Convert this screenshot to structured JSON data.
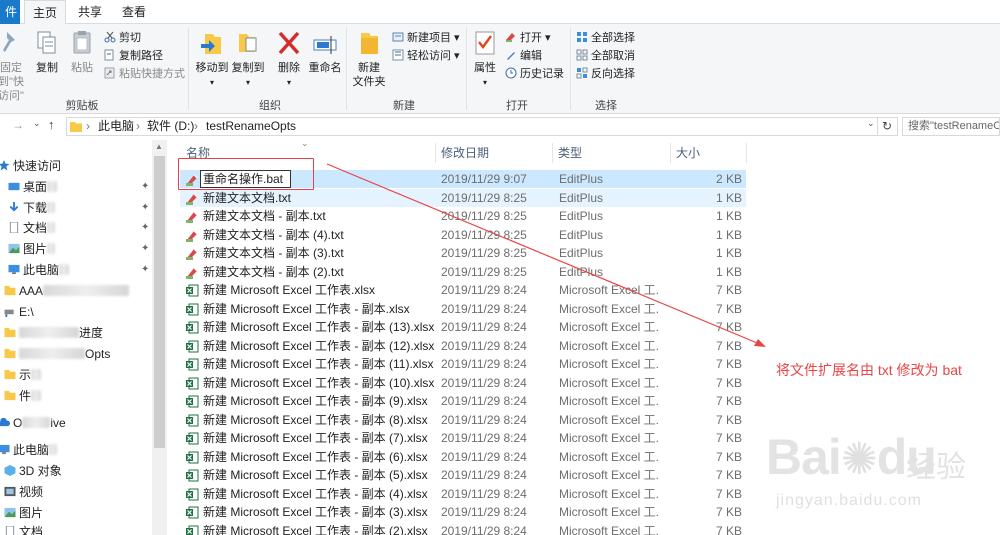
{
  "tabs": {
    "file": "件",
    "home": "主页",
    "share": "共享",
    "view": "查看"
  },
  "ribbon": {
    "clipboard": {
      "pin_label": "固定到\"快",
      "pin_label2": "访问\"",
      "copy": "复制",
      "paste": "粘贴",
      "cut": "剪切",
      "copy_path": "复制路径",
      "paste_shortcut": "粘贴快捷方式",
      "group": "剪贴板"
    },
    "organize": {
      "move_to": "移动到",
      "copy_to": "复制到",
      "delete": "删除",
      "rename": "重命名",
      "group": "组织"
    },
    "new": {
      "new_folder": "新建",
      "new_folder2": "文件夹",
      "new_item": "新建项目",
      "easy_access": "轻松访问",
      "group": "新建"
    },
    "open": {
      "properties": "属性",
      "open": "打开",
      "edit": "编辑",
      "history": "历史记录",
      "group": "打开"
    },
    "select": {
      "select_all": "全部选择",
      "select_none": "全部取消",
      "invert": "反向选择",
      "group": "选择"
    }
  },
  "address": {
    "parts": [
      "此电脑",
      "软件 (D:)",
      "testRenameOpts"
    ],
    "search_placeholder": "搜索\"testRenameOpts\""
  },
  "nav": {
    "quick_access": "快速访问",
    "items": [
      "桌面",
      "下载",
      "文档",
      "图片",
      "此电脑",
      "AAA",
      "E:\\",
      "进度",
      "Opts",
      "示",
      "件"
    ],
    "onedrive": "O",
    "onedrive_suffix": "ive",
    "this_pc": "此电脑",
    "pc_items": [
      "3D 对象",
      "视频",
      "图片",
      "文档"
    ]
  },
  "columns": {
    "name": "名称",
    "date": "修改日期",
    "type": "类型",
    "size": "大小"
  },
  "rename_value": "重命名操作.bat",
  "files": [
    {
      "name": "重命名操作.bat",
      "date": "2019/11/29 9:07",
      "type": "EditPlus",
      "size": "2 KB",
      "kind": "editplus"
    },
    {
      "name": "新建文本文档.txt",
      "date": "2019/11/29 8:25",
      "type": "EditPlus",
      "size": "1 KB",
      "kind": "editplus"
    },
    {
      "name": "新建文本文档 - 副本.txt",
      "date": "2019/11/29 8:25",
      "type": "EditPlus",
      "size": "1 KB",
      "kind": "editplus"
    },
    {
      "name": "新建文本文档 - 副本 (4).txt",
      "date": "2019/11/29 8:25",
      "type": "EditPlus",
      "size": "1 KB",
      "kind": "editplus"
    },
    {
      "name": "新建文本文档 - 副本 (3).txt",
      "date": "2019/11/29 8:25",
      "type": "EditPlus",
      "size": "1 KB",
      "kind": "editplus"
    },
    {
      "name": "新建文本文档 - 副本 (2).txt",
      "date": "2019/11/29 8:25",
      "type": "EditPlus",
      "size": "1 KB",
      "kind": "editplus"
    },
    {
      "name": "新建 Microsoft Excel 工作表.xlsx",
      "date": "2019/11/29 8:24",
      "type": "Microsoft Excel 工...",
      "size": "7 KB",
      "kind": "excel"
    },
    {
      "name": "新建 Microsoft Excel 工作表 - 副本.xlsx",
      "date": "2019/11/29 8:24",
      "type": "Microsoft Excel 工...",
      "size": "7 KB",
      "kind": "excel"
    },
    {
      "name": "新建 Microsoft Excel 工作表 - 副本 (13).xlsx",
      "date": "2019/11/29 8:24",
      "type": "Microsoft Excel 工...",
      "size": "7 KB",
      "kind": "excel"
    },
    {
      "name": "新建 Microsoft Excel 工作表 - 副本 (12).xlsx",
      "date": "2019/11/29 8:24",
      "type": "Microsoft Excel 工...",
      "size": "7 KB",
      "kind": "excel"
    },
    {
      "name": "新建 Microsoft Excel 工作表 - 副本 (11).xlsx",
      "date": "2019/11/29 8:24",
      "type": "Microsoft Excel 工...",
      "size": "7 KB",
      "kind": "excel"
    },
    {
      "name": "新建 Microsoft Excel 工作表 - 副本 (10).xlsx",
      "date": "2019/11/29 8:24",
      "type": "Microsoft Excel 工...",
      "size": "7 KB",
      "kind": "excel"
    },
    {
      "name": "新建 Microsoft Excel 工作表 - 副本 (9).xlsx",
      "date": "2019/11/29 8:24",
      "type": "Microsoft Excel 工...",
      "size": "7 KB",
      "kind": "excel"
    },
    {
      "name": "新建 Microsoft Excel 工作表 - 副本 (8).xlsx",
      "date": "2019/11/29 8:24",
      "type": "Microsoft Excel 工...",
      "size": "7 KB",
      "kind": "excel"
    },
    {
      "name": "新建 Microsoft Excel 工作表 - 副本 (7).xlsx",
      "date": "2019/11/29 8:24",
      "type": "Microsoft Excel 工...",
      "size": "7 KB",
      "kind": "excel"
    },
    {
      "name": "新建 Microsoft Excel 工作表 - 副本 (6).xlsx",
      "date": "2019/11/29 8:24",
      "type": "Microsoft Excel 工...",
      "size": "7 KB",
      "kind": "excel"
    },
    {
      "name": "新建 Microsoft Excel 工作表 - 副本 (5).xlsx",
      "date": "2019/11/29 8:24",
      "type": "Microsoft Excel 工...",
      "size": "7 KB",
      "kind": "excel"
    },
    {
      "name": "新建 Microsoft Excel 工作表 - 副本 (4).xlsx",
      "date": "2019/11/29 8:24",
      "type": "Microsoft Excel 工...",
      "size": "7 KB",
      "kind": "excel"
    },
    {
      "name": "新建 Microsoft Excel 工作表 - 副本 (3).xlsx",
      "date": "2019/11/29 8:24",
      "type": "Microsoft Excel 工...",
      "size": "7 KB",
      "kind": "excel"
    },
    {
      "name": "新建 Microsoft Excel 工作表 - 副本 (2).xlsx",
      "date": "2019/11/29 8:24",
      "type": "Microsoft Excel 工...",
      "size": "7 KB",
      "kind": "excel"
    }
  ],
  "annotation": "将文件扩展名由 txt 修改为 bat",
  "watermark": {
    "brand": "Bai",
    "brand2": "du",
    "cn": "经验",
    "url": "jingyan.baidu.com"
  },
  "colors": {
    "accent": "#1979ca",
    "annotation": "#e84545",
    "selection": "#cce8ff"
  }
}
